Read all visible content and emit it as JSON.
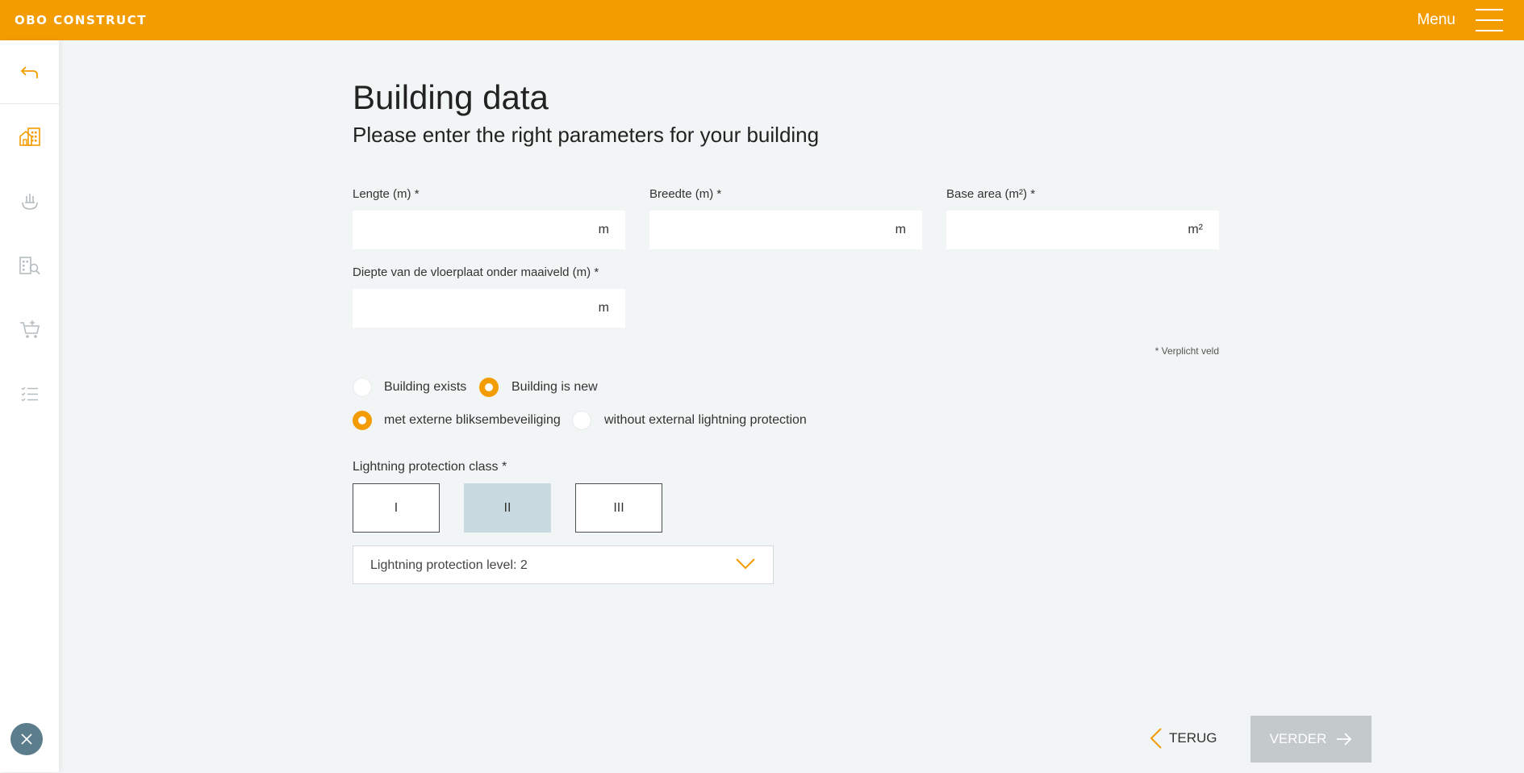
{
  "header": {
    "logo": "OBO CONSTRUCT",
    "menu_label": "Menu"
  },
  "sidebar": {
    "icons": [
      "back-arrow-icon",
      "building-data-icon",
      "earthing-icon",
      "building-search-icon",
      "cart-add-icon",
      "checklist-icon"
    ],
    "close_icon": "close-icon"
  },
  "page": {
    "title": "Building data",
    "subtitle": "Please enter the right parameters for your building"
  },
  "fields": {
    "length": {
      "label": "Lengte (m) *",
      "unit": "m",
      "value": ""
    },
    "width": {
      "label": "Breedte (m) *",
      "unit": "m",
      "value": ""
    },
    "base_area": {
      "label": "Base area (m²) *",
      "unit": "m²",
      "value": ""
    },
    "depth": {
      "label": "Diepte van de vloerplaat onder maaiveld (m) *",
      "unit": "m",
      "value": ""
    }
  },
  "required_note": "* Verplicht veld",
  "building_status": {
    "options": [
      "Building exists",
      "Building is new"
    ],
    "selected": "Building is new"
  },
  "lightning_external": {
    "options": [
      "met externe bliksembeveiliging",
      "without external lightning protection"
    ],
    "selected": "met externe bliksembeveiliging"
  },
  "protection_class": {
    "label": "Lightning protection class *",
    "options": [
      "I",
      "II",
      "III"
    ],
    "selected": "II"
  },
  "protection_level": {
    "value": "Lightning protection level: 2"
  },
  "footer": {
    "back_label": "TERUG",
    "next_label": "VERDER"
  },
  "colors": {
    "brand_orange": "#f39c00",
    "page_bg": "#f2f5f5",
    "active_class_bg": "#c9dbe0",
    "disabled_button": "#c4c9cc",
    "close_button": "#5c7d8c"
  }
}
